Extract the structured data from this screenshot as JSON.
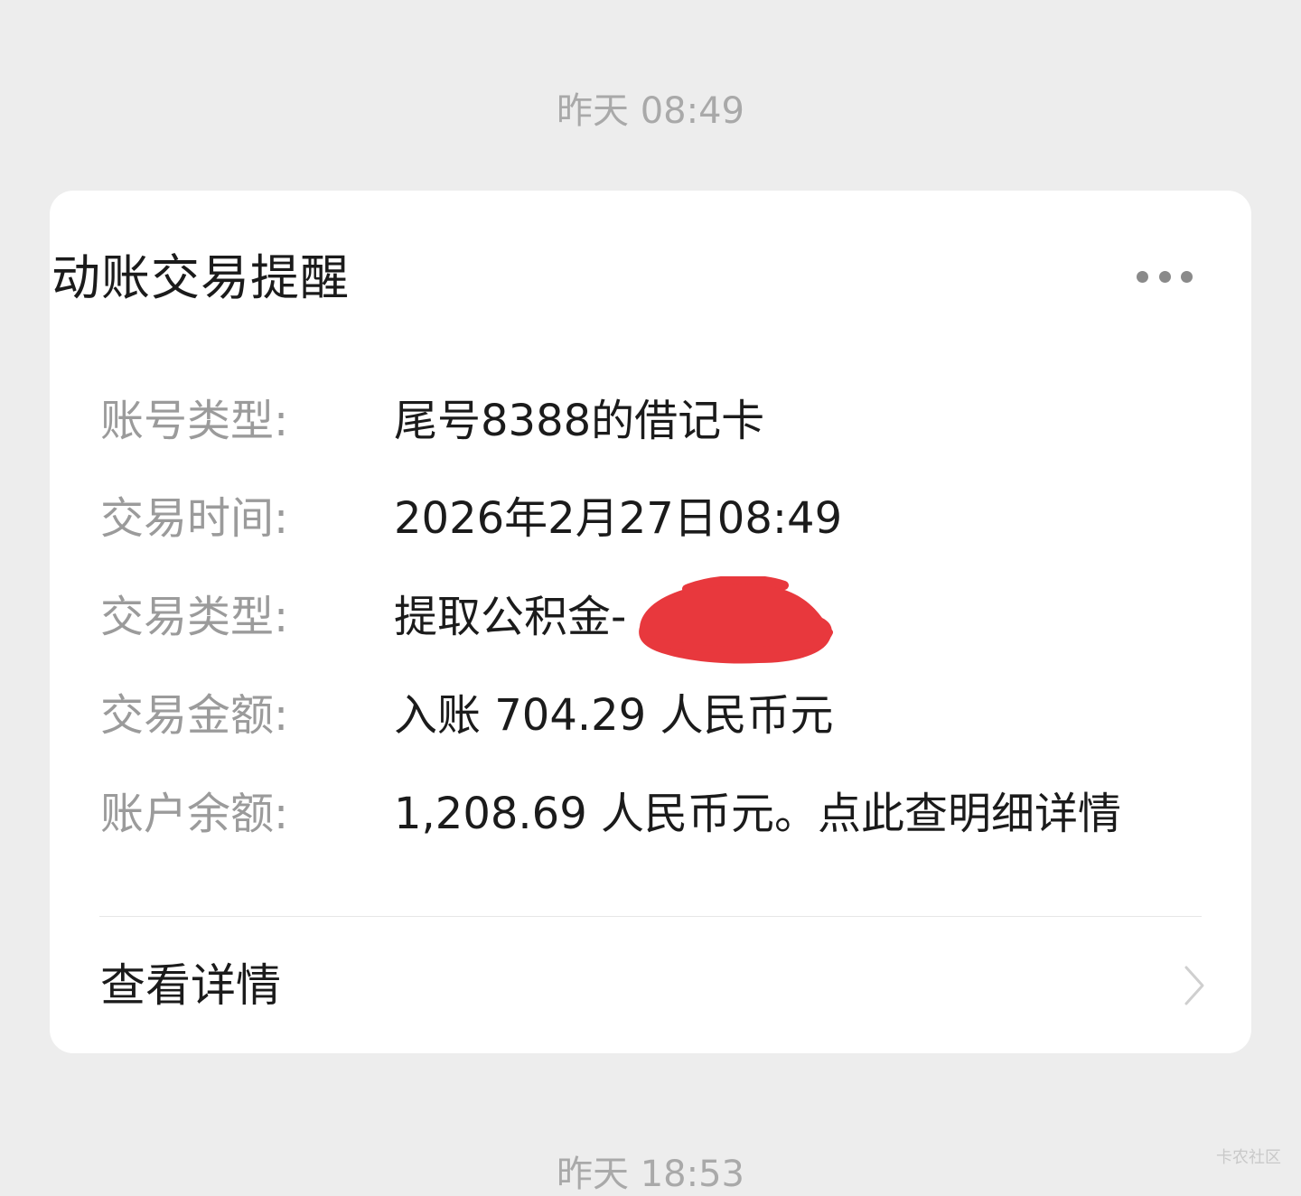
{
  "timestamps": {
    "top": "昨天 08:49",
    "bottom": "昨天 18:53"
  },
  "card": {
    "title": "动账交易提醒",
    "more_icon": "more-horizontal-icon",
    "rows": [
      {
        "label": "账号类型:",
        "value": "尾号8388的借记卡"
      },
      {
        "label": "交易时间:",
        "value": "2026年2月27日08:49"
      },
      {
        "label": "交易类型:",
        "value": "提取公积金-"
      },
      {
        "label": "交易金额:",
        "value": "入账 704.29 人民币元"
      },
      {
        "label": "账户余额:",
        "value": "1,208.69 人民币元。点此查明细详情"
      }
    ],
    "details_label": "查看详情",
    "details_icon": "chevron-right-icon"
  },
  "watermark": "卡农社区",
  "colors": {
    "background": "#ededed",
    "card": "#ffffff",
    "redaction": "#e8383d",
    "label": "#9b9b9b",
    "value": "#1b1b1b"
  }
}
